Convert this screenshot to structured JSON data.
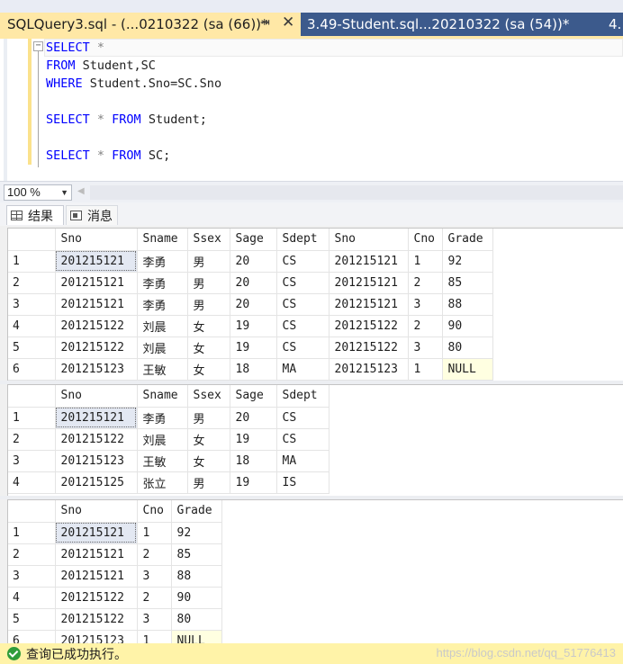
{
  "tabs": {
    "active": {
      "title": "SQLQuery3.sql - (...0210322 (sa (66))*",
      "pin": "⇥",
      "close": "✕"
    },
    "inactive": {
      "title": "3.49-Student.sql...20210322 (sa (54))*",
      "more": "4."
    }
  },
  "editor": {
    "lines": [
      {
        "kw1": "SELECT",
        "rest": " *"
      },
      {
        "kw1": "FROM",
        "rest": " Student,SC"
      },
      {
        "kw1": "WHERE",
        "rest": " Student.Sno=SC.Sno"
      },
      {
        "kw1": "",
        "rest": ""
      },
      {
        "kw1": "SELECT",
        "mid": " * ",
        "kw2": "FROM",
        "rest": " Student;"
      },
      {
        "kw1": "",
        "rest": ""
      },
      {
        "kw1": "SELECT",
        "mid": " * ",
        "kw2": "FROM",
        "rest": " SC;"
      }
    ]
  },
  "zoom": {
    "value": "100 %"
  },
  "result_tabs": {
    "results": "结果",
    "messages": "消息"
  },
  "grid1": {
    "columns": [
      "Sno",
      "Sname",
      "Ssex",
      "Sage",
      "Sdept",
      "Sno",
      "Cno",
      "Grade"
    ],
    "rows": [
      [
        "1",
        "201215121",
        "李勇",
        "男",
        "20",
        "CS",
        "201215121",
        "1",
        "92"
      ],
      [
        "2",
        "201215121",
        "李勇",
        "男",
        "20",
        "CS",
        "201215121",
        "2",
        "85"
      ],
      [
        "3",
        "201215121",
        "李勇",
        "男",
        "20",
        "CS",
        "201215121",
        "3",
        "88"
      ],
      [
        "4",
        "201215122",
        "刘晨",
        "女",
        "19",
        "CS",
        "201215122",
        "2",
        "90"
      ],
      [
        "5",
        "201215122",
        "刘晨",
        "女",
        "19",
        "CS",
        "201215122",
        "3",
        "80"
      ],
      [
        "6",
        "201215123",
        "王敏",
        "女",
        "18",
        "MA",
        "201215123",
        "1",
        "NULL"
      ]
    ]
  },
  "grid2": {
    "columns": [
      "Sno",
      "Sname",
      "Ssex",
      "Sage",
      "Sdept"
    ],
    "rows": [
      [
        "1",
        "201215121",
        "李勇",
        "男",
        "20",
        "CS"
      ],
      [
        "2",
        "201215122",
        "刘晨",
        "女",
        "19",
        "CS"
      ],
      [
        "3",
        "201215123",
        "王敏",
        "女",
        "18",
        "MA"
      ],
      [
        "4",
        "201215125",
        "张立",
        "男",
        "19",
        "IS"
      ]
    ]
  },
  "grid3": {
    "columns": [
      "Sno",
      "Cno",
      "Grade"
    ],
    "rows": [
      [
        "1",
        "201215121",
        "1",
        "92"
      ],
      [
        "2",
        "201215121",
        "2",
        "85"
      ],
      [
        "3",
        "201215121",
        "3",
        "88"
      ],
      [
        "4",
        "201215122",
        "2",
        "90"
      ],
      [
        "5",
        "201215122",
        "3",
        "80"
      ],
      [
        "6",
        "201215123",
        "1",
        "NULL"
      ]
    ]
  },
  "status": {
    "message": "查询已成功执行。",
    "watermark": "https://blog.csdn.net/qq_51776413"
  },
  "colors": {
    "tab_active": "#ffe8a6",
    "tab_inactive": "#3c5a8c",
    "status_bar": "#fff3a8",
    "keyword": "#0000ff",
    "null_cell": "#ffffe1"
  }
}
